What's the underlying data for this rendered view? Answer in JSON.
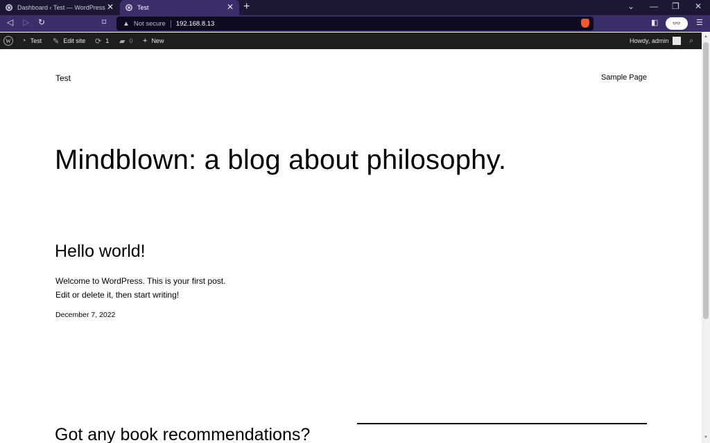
{
  "browser": {
    "tabs": [
      {
        "title": "Dashboard ‹ Test — WordPress",
        "active": false
      },
      {
        "title": "Test",
        "active": true
      }
    ],
    "new_tab_glyph": "+",
    "address": {
      "security_label": "Not secure",
      "url": "192.168.8.13"
    }
  },
  "adminbar": {
    "site_name": "Test",
    "edit_site": "Edit site",
    "updates_count": "1",
    "comments_count": "0",
    "new_label": "New",
    "greeting": "Howdy, admin"
  },
  "page": {
    "site_title": "Test",
    "nav_link": "Sample Page",
    "hero": "Mindblown: a blog about philosophy.",
    "post": {
      "title": "Hello world!",
      "excerpt_line1": "Welcome to WordPress. This is your first post.",
      "excerpt_line2": "Edit or delete it, then start writing!",
      "date": "December 7, 2022"
    },
    "section_title": "Got any book recommendations?"
  },
  "colors": {
    "tabstrip": "#1c1733",
    "toolbar": "#3a2f6b",
    "adminbar": "#1e1e1e"
  }
}
